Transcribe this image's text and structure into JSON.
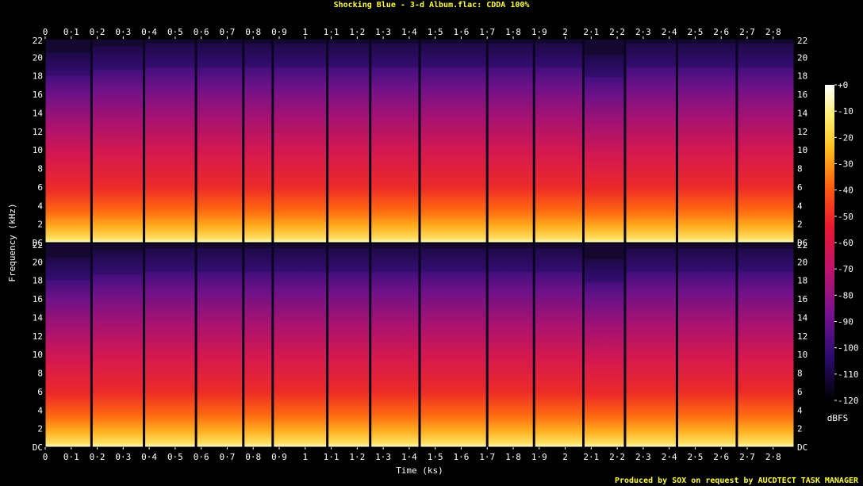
{
  "title": "Shocking Blue  - 3-d Album.flac: CDDA 100%",
  "footer": "Produced by SOX on request by AUCDTECT TASK MANAGER",
  "chart_data": {
    "type": "heatmap",
    "xlabel": "Time (ks)",
    "ylabel": "Frequency (kHz)",
    "xlim": [
      0,
      2.88
    ],
    "ylim": [
      0,
      22
    ],
    "x_ticks": [
      "0",
      "0·1",
      "0·2",
      "0·3",
      "0·4",
      "0·5",
      "0·6",
      "0·7",
      "0·8",
      "0·9",
      "1",
      "1·1",
      "1·2",
      "1·3",
      "1·4",
      "1·5",
      "1·6",
      "1·7",
      "1·8",
      "1·9",
      "2",
      "2·1",
      "2·2",
      "2·3",
      "2·4",
      "2·5",
      "2·6",
      "2·7",
      "2·8"
    ],
    "y_ticks": [
      "DC",
      "2",
      "4",
      "6",
      "8",
      "10",
      "12",
      "14",
      "16",
      "18",
      "20",
      "22"
    ],
    "colorbar_label": "dBFS",
    "colorbar_ticks": [
      "+0",
      "-10",
      "-20",
      "-30",
      "-40",
      "-50",
      "-60",
      "-70",
      "-80",
      "-90",
      "-100",
      "-110",
      "-120"
    ],
    "channels": 2,
    "track_boundaries_ks": [
      0.0,
      0.178,
      0.38,
      0.58,
      0.762,
      0.875,
      1.085,
      1.25,
      1.44,
      1.7,
      1.88,
      2.07,
      2.23,
      2.43,
      2.66,
      2.88
    ],
    "track_cutoff_khz": [
      20.5,
      21.2,
      21.5,
      21.5,
      21.5,
      21.5,
      21.5,
      21.5,
      21.5,
      21.5,
      21.5,
      20.3,
      21.5,
      21.5,
      21.5
    ]
  }
}
